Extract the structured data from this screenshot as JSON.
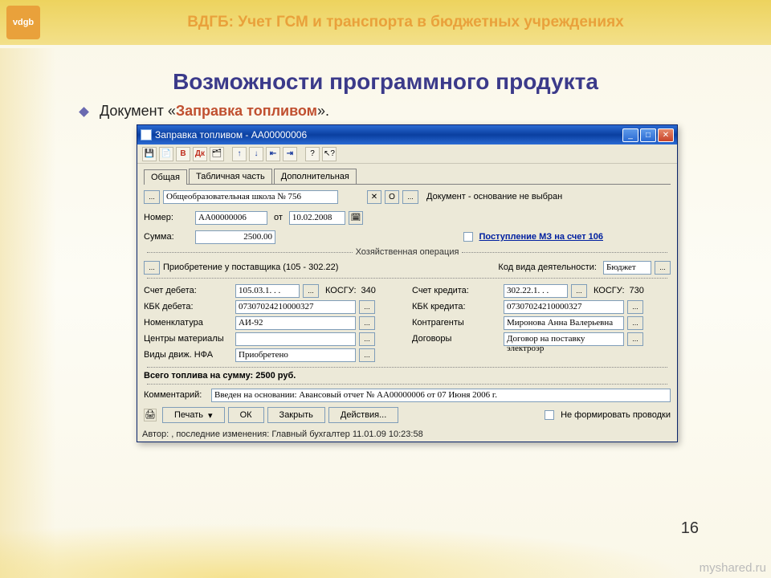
{
  "slide": {
    "header": "ВДГБ: Учет ГСМ и транспорта в бюджетных учреждениях",
    "title": "Возможности программного продукта",
    "subtitle_prefix": "Документ «",
    "subtitle_accent": "Заправка топливом",
    "subtitle_suffix": "».",
    "page_num": "16",
    "watermark": "myshared.ru",
    "logo": "vdgb"
  },
  "win": {
    "title": "Заправка топливом - АА00000006",
    "menu": {
      "file": "⎘",
      "edit": "✎"
    },
    "tabs": {
      "t1": "Общая",
      "t2": "Табличная часть",
      "t3": "Дополнительная"
    },
    "top": {
      "org": "Общеобразовательная школа № 756",
      "doc_basis": "Документ - основание не выбран"
    },
    "fields": {
      "number_lbl": "Номер:",
      "number": "АА00000006",
      "from_lbl": "от",
      "date": "10.02.2008",
      "sum_lbl": "Сумма:",
      "sum": "2500.00",
      "chk_label": "Поступление МЗ на счет 106"
    },
    "group1": "Хозяйственная операция",
    "op_desc": "Приобретение у поставщика (105 - 302.22)",
    "kvd_lbl": "Код вида деятельности:",
    "kvd": "Бюджет",
    "left": {
      "l1_lbl": "Счет дебета:",
      "l1": "105.03.1. .   .",
      "l1b_lbl": "КОСГУ:",
      "l1b": "340",
      "l2_lbl": "КБК дебета:",
      "l2": "07307024210000327",
      "l3_lbl": "Номенклатура",
      "l3": "АИ-92",
      "l4_lbl": "Центры материалы",
      "l4": "",
      "l5_lbl": "Виды движ. НФА",
      "l5": "Приобретено"
    },
    "right": {
      "r1_lbl": "Счет кредита:",
      "r1": "302.22.1. .   .",
      "r1b_lbl": "КОСГУ:",
      "r1b": "730",
      "r2_lbl": "КБК кредита:",
      "r2": "07307024210000327",
      "r3_lbl": "Контрагенты",
      "r3": "Миронова Анна Валерьевна",
      "r4_lbl": "Договоры",
      "r4": "Договор на поставку электроэр"
    },
    "total": "Всего топлива на сумму: 2500 руб.",
    "comment_lbl": "Комментарий:",
    "comment": "Введен на основании: Авансовый отчет № АА00000006 от 07 Июня 2006 г.",
    "buttons": {
      "print": "Печать",
      "ok": "ОК",
      "close": "Закрыть",
      "actions": "Действия..."
    },
    "chk2": "Не формировать проводки",
    "status": "Автор: , последние изменения: Главный бухгалтер 11.01.09 10:23:58"
  }
}
